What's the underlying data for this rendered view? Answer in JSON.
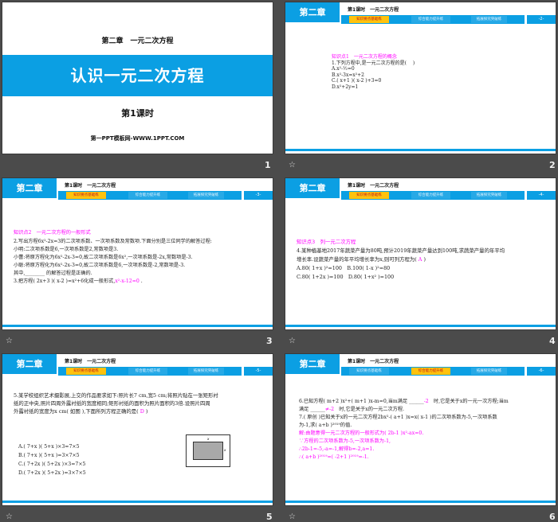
{
  "slide1": {
    "chapter": "第二章　一元二次方程",
    "title": "认识一元二次方程",
    "subtitle": "第1课时",
    "site": "第一PPT模板网-WWW.1PPT.COM",
    "number": "1"
  },
  "header": {
    "chapter": "第二章",
    "lesson_title": "第1课时　一元二次方程",
    "tabs": [
      "知识要点基础练",
      "综合能力提升练",
      "拓展探究突破练"
    ]
  },
  "colors": {
    "accent": "#0b9fe3",
    "highlight": "#ffc20e",
    "answer": "#ff00ff"
  },
  "star_icon": "☆",
  "slides": [
    {
      "number": "2",
      "page": "-2-",
      "active_tab": 0,
      "lines": [
        [
          {
            "t": "知识点1　一元二次方程的概念",
            "c": "#ff00ff"
          }
        ],
        [
          {
            "t": "1.下列方程中,是一元二次方程的是(　 )"
          }
        ],
        [
          {
            "t": "A.x²-½=0"
          }
        ],
        [
          {
            "t": "B.x²-3x=x²+2"
          }
        ],
        [
          {
            "t": "C.( x+1 )( x-2 )+3=0"
          }
        ],
        [
          {
            "t": "D.x²+2y=1"
          }
        ]
      ]
    },
    {
      "number": "3",
      "page": "-3-",
      "active_tab": 0,
      "lines": [
        [
          {
            "t": "知识点2　一元二次方程的一般形式",
            "c": "#ff00ff"
          }
        ],
        [
          {
            "t": "2.写出方程6x²-2x=3的二次项系数、一次项系数及常数项.下面分别是三位同学的解答过程:"
          }
        ],
        [
          {
            "t": "小明:二次项系数是6,一次项系数是2,常数项是3."
          }
        ],
        [
          {
            "t": "小蕾:将原方程化为6x²-2x-3=0,故二次项系数是6x²,一次项系数是-2x,常数项是-3."
          }
        ],
        [
          {
            "t": "小聪:将原方程化为6x²-2x-3=0,故二次项系数是6,一次项系数是-2,常数项是-3."
          }
        ],
        [
          {
            "t": "其中,________ 的解答过程是正确的."
          }
        ],
        [
          {
            "t": "3.把方程( 2x+3 )( x-2 )=x²+6化成一般形式,"
          },
          {
            "t": "x²-x-12=0",
            "c": "#ff00ff"
          },
          {
            "t": " ."
          }
        ]
      ]
    },
    {
      "number": "4",
      "page": "-4-",
      "active_tab": 0,
      "lines": [
        [
          {
            "t": "知识点3　列一元二次方程",
            "c": "#ff00ff"
          }
        ],
        [
          {
            "t": "4.某种植基地2017年蔬菜产量为80吨,预计2019年蔬菜产量达到100吨,求蔬菜产量的年平均"
          }
        ],
        [
          {
            "t": "增长率.设蔬菜产量的年平均增长率为x,则可列方程为( "
          },
          {
            "t": "A",
            "c": "#ff00ff"
          },
          {
            "t": " )"
          }
        ],
        [
          {
            "t": "A.80( 1+x )²=100　B.100( 1-x )²=80"
          }
        ],
        [
          {
            "t": "C.80( 1+2x )=100　D.80( 1+x² )=100"
          }
        ]
      ]
    },
    {
      "number": "5",
      "page": "-5-",
      "active_tab": 0,
      "lines": [
        [
          {
            "t": "5.某学校组织艺术摄影展,上交的作品要求如下:照片长7 cm,宽5 cm;将照片贴在一张矩形衬"
          }
        ],
        [
          {
            "t": "纸的正中央,照片四周外露衬纸的宽度相同;矩形衬纸的面积为照片面积的3倍.设照片四周"
          }
        ],
        [
          {
            "t": "外露衬纸的宽度为x cm( 如图 ),下面所列方程正确的是( "
          },
          {
            "t": "D",
            "c": "#ff00ff"
          },
          {
            "t": " )"
          }
        ]
      ],
      "options": [
        "A.( 7+x )( 5+x )×3=7×5",
        "B.( 7+x )( 5+x )=3×7×5",
        "C.( 7+2x )( 5+2x )×3=7×5",
        "D.( 7+2x )( 5+2x )=3×7×5"
      ],
      "figure_label": "x"
    },
    {
      "number": "6",
      "page": "-6-",
      "active_tab": 1,
      "lines": [
        [
          {
            "t": "6.已知方程( m+2 )x²+( m+1 )x-m=0,当m满足 ______"
          },
          {
            "t": "-2",
            "c": "#ff00ff"
          },
          {
            "t": "　时,它是关于x的一元一次方程;当m"
          }
        ],
        [
          {
            "t": "满足 ______"
          },
          {
            "t": "≠-2",
            "c": "#ff00ff"
          },
          {
            "t": "　时,它是关于x的一元二次方程."
          }
        ],
        [
          {
            "t": "7.( 原创 )已知关于x的一元二次方程2bx²-( a+1 )x=x( x-1 )的二次项系数为-5,一次项系数"
          }
        ],
        [
          {
            "t": "为-1,求( a+b )²⁰¹⁹的值."
          }
        ],
        [
          {
            "t": ""
          }
        ],
        [
          {
            "t": "解:由题意得一元二次方程的一般形式为( 2b-1 )x²-ax=0.",
            "c": "#ff00ff"
          }
        ],
        [
          {
            "t": "∵方程的二次项系数为-5,一次项系数为-1,",
            "c": "#ff00ff"
          }
        ],
        [
          {
            "t": "∴2b-1=-5,-a=-1,解得b=-2,a=1.",
            "c": "#ff00ff"
          }
        ],
        [
          {
            "t": "∴( a+b )²⁰¹⁹=( -2+1 )²⁰¹⁹=-1.",
            "c": "#ff00ff"
          }
        ]
      ]
    }
  ]
}
